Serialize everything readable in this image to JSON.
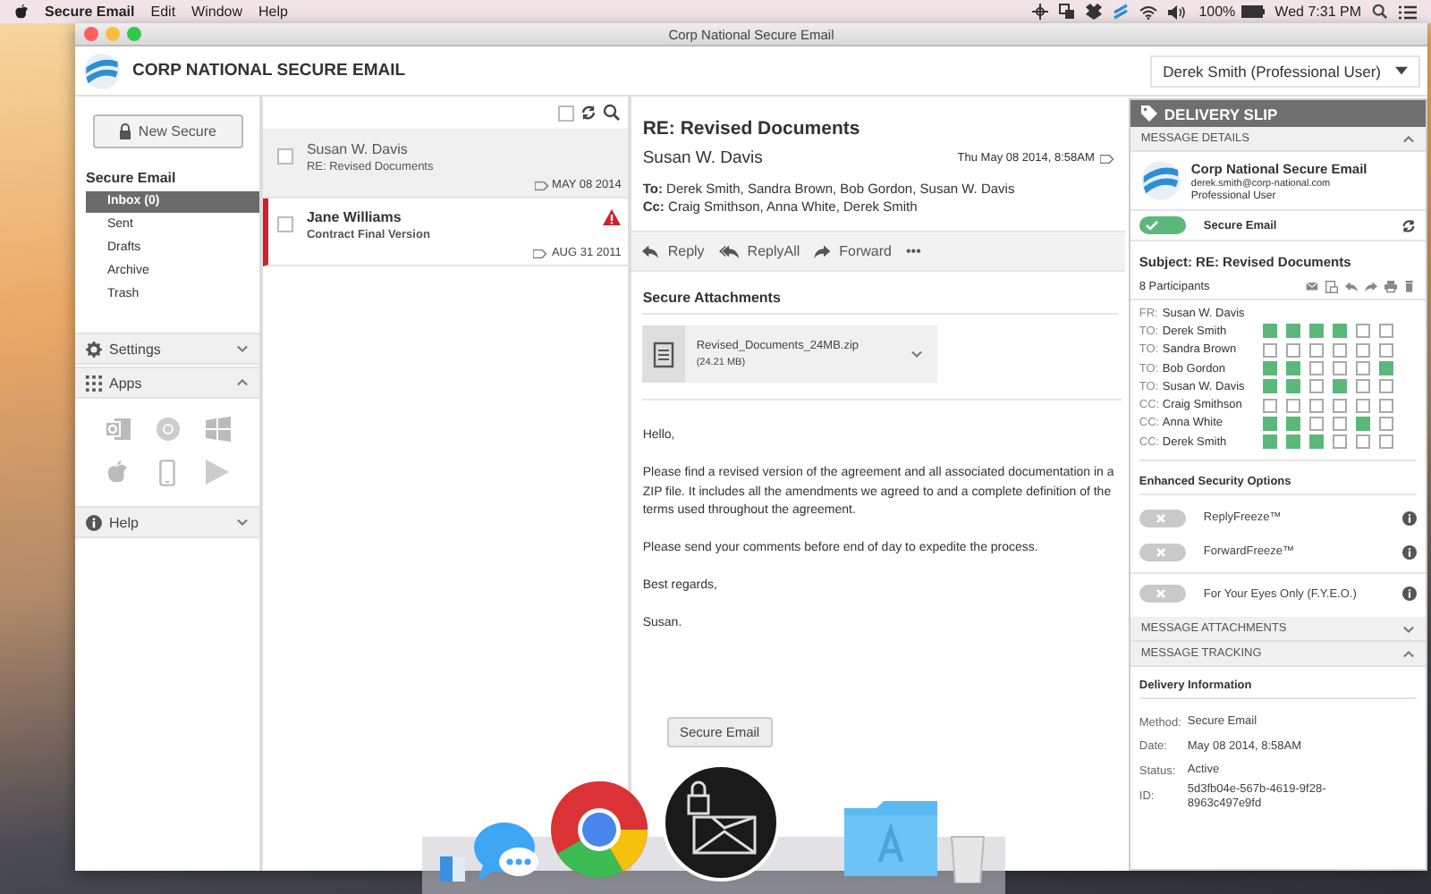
{
  "menubar": {
    "app": "Secure Email",
    "menus": [
      "Edit",
      "Window",
      "Help"
    ],
    "battery": "100%",
    "clock": "Wed 7:31 PM"
  },
  "window": {
    "title": "Corp National Secure Email"
  },
  "header": {
    "brand": "CORP NATIONAL SECURE EMAIL",
    "user": "Derek Smith (Professional User)"
  },
  "sidebar": {
    "new_button": "New Secure",
    "section": "Secure Email",
    "folders": [
      {
        "label": "Inbox (0)",
        "selected": true
      },
      {
        "label": "Sent",
        "selected": false
      },
      {
        "label": "Drafts",
        "selected": false
      },
      {
        "label": "Archive",
        "selected": false
      },
      {
        "label": "Trash",
        "selected": false
      }
    ],
    "panels": [
      {
        "kind": "settings",
        "label": "Settings",
        "expanded": false
      },
      {
        "kind": "apps",
        "label": "Apps",
        "expanded": true
      },
      {
        "kind": "help",
        "label": "Help",
        "expanded": false
      }
    ]
  },
  "list": {
    "select_all_checked": false
  },
  "messages": [
    {
      "sender": "Susan W. Davis",
      "subject": "RE: Revised Documents",
      "date": "MAY 08 2014",
      "selected": true,
      "unread": false,
      "flagged": false,
      "checked": false
    },
    {
      "sender": "Jane Williams",
      "subject": "Contract Final Version",
      "date": "AUG 31 2011",
      "selected": false,
      "unread": true,
      "flagged": true,
      "checked": false
    }
  ],
  "reader": {
    "subject": "RE: Revised Documents",
    "sender": "Susan W. Davis",
    "date": "Thu May 08 2014, 8:58AM",
    "to_label": "To:",
    "to": "Derek Smith, Sandra Brown, Bob Gordon, Susan W. Davis",
    "cc_label": "Cc:",
    "cc": "Craig Smithson, Anna White, Derek Smith",
    "actions": [
      "Reply",
      "ReplyAll",
      "Forward"
    ],
    "more": "•••",
    "attachments_title": "Secure Attachments",
    "attachment": {
      "name": "Revised_Documents_24MB.zip",
      "size": "(24.21 MB)"
    },
    "body": [
      "Hello,",
      "Please find a revised version of the agreement and all associated documentation in a ZIP file. It includes all the amendments we agreed to and a complete definition of the terms used throughout the agreement.",
      "Please send your comments before end of day to expedite the process.",
      "Best regards,",
      "Susan."
    ]
  },
  "slip": {
    "title": "DELIVERY SLIP",
    "details": {
      "label": "MESSAGE DETAILS",
      "expanded": true
    },
    "org": "Corp National Secure Email",
    "email": "derek.smith@corp-national.com",
    "role": "Professional User",
    "secure": {
      "label": "Secure Email",
      "on": true
    },
    "subject": "Subject: RE: Revised Documents",
    "participants_label": "8 Participants",
    "participants": [
      {
        "role": "FR:",
        "name": "Susan W. Davis"
      },
      {
        "role": "TO:",
        "name": "Derek Smith",
        "perms": [
          true,
          true,
          true,
          true,
          false,
          false
        ]
      },
      {
        "role": "TO:",
        "name": "Sandra Brown",
        "perms": [
          false,
          false,
          false,
          false,
          false,
          false
        ]
      },
      {
        "role": "TO:",
        "name": "Bob Gordon",
        "perms": [
          true,
          true,
          false,
          false,
          false,
          true
        ]
      },
      {
        "role": "TO:",
        "name": "Susan W. Davis",
        "perms": [
          true,
          true,
          false,
          true,
          false,
          false
        ]
      },
      {
        "role": "CC:",
        "name": "Craig Smithson",
        "perms": [
          false,
          false,
          false,
          false,
          false,
          false
        ]
      },
      {
        "role": "CC:",
        "name": "Anna White",
        "perms": [
          true,
          true,
          false,
          false,
          true,
          false
        ]
      },
      {
        "role": "CC:",
        "name": "Derek Smith",
        "perms": [
          true,
          true,
          true,
          false,
          false,
          false
        ]
      }
    ],
    "options_title": "Enhanced Security Options",
    "options": [
      {
        "label": "ReplyFreeze™",
        "on": false
      },
      {
        "label": "ForwardFreeze™",
        "on": false
      },
      {
        "label": "For Your Eyes Only (F.Y.E.O.)",
        "on": false
      }
    ],
    "attachments": {
      "label": "MESSAGE ATTACHMENTS",
      "expanded": false
    },
    "tracking": {
      "label": "MESSAGE TRACKING",
      "expanded": true
    },
    "delivery_title": "Delivery Information",
    "delivery": [
      {
        "label": "Method:",
        "value": "Secure Email"
      },
      {
        "label": "Date:",
        "value": "May 08 2014, 8:58AM"
      },
      {
        "label": "Status:",
        "value": "Active"
      },
      {
        "label": "ID:",
        "value": "5d3fb04e-567b-4619-9f28-8963c497e9fd"
      }
    ]
  },
  "dock": {
    "tooltip": "Secure Email"
  }
}
